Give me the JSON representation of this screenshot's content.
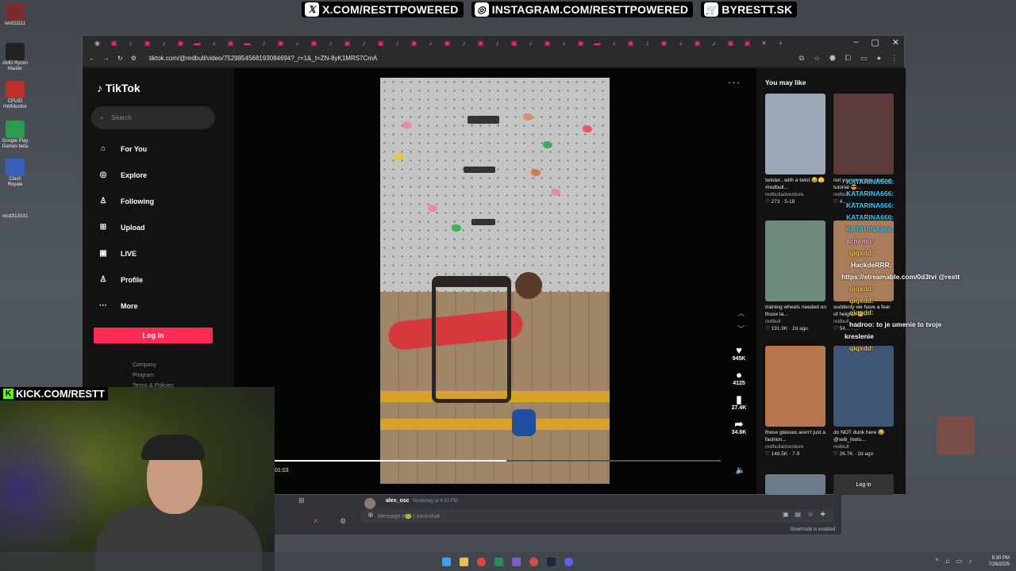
{
  "stream_banner": {
    "x_handle": "X.COM/RESTTPOWERED",
    "instagram_handle": "INSTAGRAM.COM/RESTTPOWERED",
    "shop": "BYRESTT.SK"
  },
  "desktop_icons": [
    {
      "label": "restt11111",
      "color": "#7a2b2b"
    },
    {
      "label": "AMD Ryzen Master",
      "color": "#222222"
    },
    {
      "label": "CPUID HWMonitor",
      "color": "#c0302f"
    },
    {
      "label": "Google Play Games beta",
      "color": "#2d9b4f"
    },
    {
      "label": "Clash Royale",
      "color": "#3b5fbf"
    },
    {
      "label": "restt313131",
      "color": "#555555"
    }
  ],
  "browser": {
    "url": "tiktok.com/@redbull/video/7529854568193084694?_r=1&_t=ZN-8yK1MRS7CmA"
  },
  "tiktok": {
    "logo": "TikTok",
    "search_placeholder": "Search",
    "nav": [
      {
        "label": "For You",
        "icon": "home-icon"
      },
      {
        "label": "Explore",
        "icon": "compass-icon"
      },
      {
        "label": "Following",
        "icon": "user-plus-icon"
      },
      {
        "label": "Upload",
        "icon": "upload-icon"
      },
      {
        "label": "LIVE",
        "icon": "live-icon"
      },
      {
        "label": "Profile",
        "icon": "user-icon"
      },
      {
        "label": "More",
        "icon": "more-icon"
      }
    ],
    "login_label": "Log in",
    "footer_links": [
      "Company",
      "Program",
      "Terms & Policies"
    ],
    "video": {
      "time": "01:03",
      "progress": 0.52,
      "likes": "945K",
      "comments": "4125",
      "saves": "27.4K",
      "shares": "34.6K"
    },
    "rail_title": "You may like",
    "recommended": [
      {
        "title": "twister.. with a twist 😂🫣 #redbull...",
        "user": "redbulladventure",
        "meta": "♡ 273 · 5-18",
        "color": "#9aa9b5"
      },
      {
        "title": "not your average start up tutorial 😎...",
        "user": "redbull",
        "meta": "♡ 4... · ...",
        "color": "#5a3a3a"
      },
      {
        "title": "training wheels needed on those la...",
        "user": "redbull",
        "meta": "♡ 191.9K · 2d ago",
        "color": "#6e8a7d"
      },
      {
        "title": "suddenly we have a fear of heights 😬...",
        "user": "redbull",
        "meta": "♡ 54... · ...",
        "color": "#a77d5b"
      },
      {
        "title": "these glasses aren't just a fashion...",
        "user": "redbulladventure",
        "meta": "♡ 148.5K · 7-9",
        "color": "#b5764e"
      },
      {
        "title": "do NOT dunk here 😂 @seb_toots...",
        "user": "redbull",
        "meta": "♡ 26.7K · 2d ago",
        "color": "#3f5575"
      }
    ],
    "rail_login": "Log in"
  },
  "chat_overlay": [
    "KATARINA666:",
    "KATARINA666:",
    "KATARINA666:",
    "KATARINA666:",
    "KATARINA666:",
    "schemo:",
    "qiqxdd:",
    "HackdeRRR:",
    "https://streamable.com/0d3tvi @restt",
    "qiqxdd:",
    "qiqxdd:",
    "qiqxdd:",
    "hadroo: to je umenie to tvoje",
    "kreslenie",
    "qiqxdd:"
  ],
  "kick_handle": "KICK.COM/RESTT",
  "discord": {
    "author": "alex_osc",
    "timestamp": "Yesterday at 4:23 PM",
    "input_placeholder": "Message #🐸 | intro-chat",
    "slowmode": "Slowmode is enabled."
  },
  "clock": {
    "time": "8:30 PM",
    "date": "7/26/2025"
  }
}
